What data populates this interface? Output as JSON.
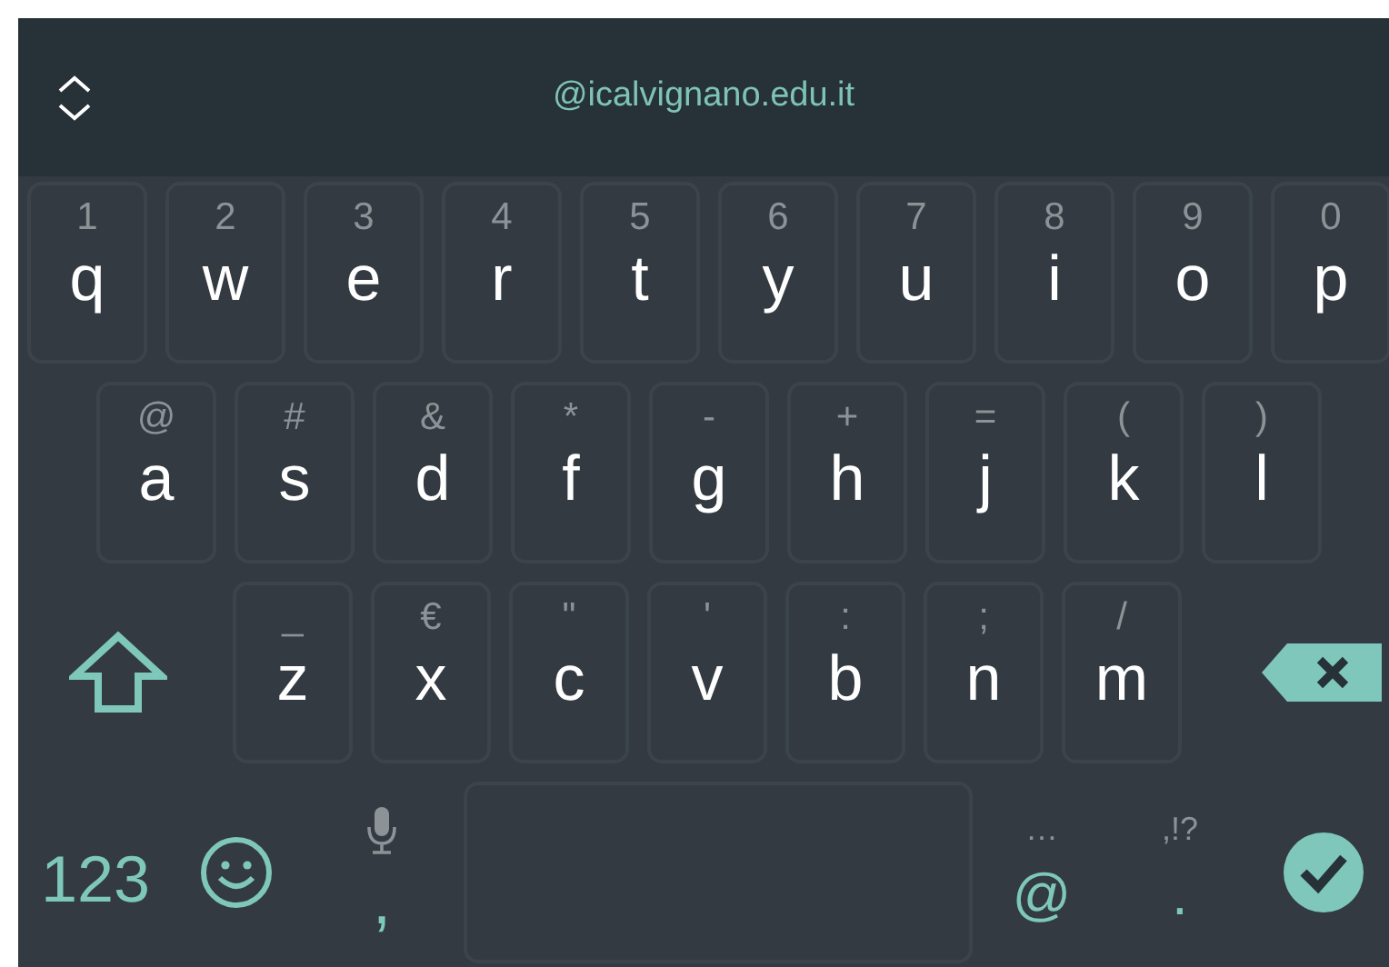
{
  "suggestion_bar": {
    "suggestion": "@icalvignano.edu.it"
  },
  "rows": [
    {
      "keys": [
        {
          "kind": "letter",
          "label": "q",
          "hint": "1"
        },
        {
          "kind": "letter",
          "label": "w",
          "hint": "2"
        },
        {
          "kind": "letter",
          "label": "e",
          "hint": "3"
        },
        {
          "kind": "letter",
          "label": "r",
          "hint": "4"
        },
        {
          "kind": "letter",
          "label": "t",
          "hint": "5"
        },
        {
          "kind": "letter",
          "label": "y",
          "hint": "6"
        },
        {
          "kind": "letter",
          "label": "u",
          "hint": "7"
        },
        {
          "kind": "letter",
          "label": "i",
          "hint": "8"
        },
        {
          "kind": "letter",
          "label": "o",
          "hint": "9"
        },
        {
          "kind": "letter",
          "label": "p",
          "hint": "0"
        }
      ]
    },
    {
      "keys": [
        {
          "kind": "letter",
          "label": "a",
          "hint": "@"
        },
        {
          "kind": "letter",
          "label": "s",
          "hint": "#"
        },
        {
          "kind": "letter",
          "label": "d",
          "hint": "&"
        },
        {
          "kind": "letter",
          "label": "f",
          "hint": "*"
        },
        {
          "kind": "letter",
          "label": "g",
          "hint": "-"
        },
        {
          "kind": "letter",
          "label": "h",
          "hint": "+"
        },
        {
          "kind": "letter",
          "label": "j",
          "hint": "="
        },
        {
          "kind": "letter",
          "label": "k",
          "hint": "("
        },
        {
          "kind": "letter",
          "label": "l",
          "hint": ")"
        }
      ]
    },
    {
      "keys": [
        {
          "kind": "shift"
        },
        {
          "kind": "letter",
          "label": "z",
          "hint": "_"
        },
        {
          "kind": "letter",
          "label": "x",
          "hint": "€"
        },
        {
          "kind": "letter",
          "label": "c",
          "hint": "\""
        },
        {
          "kind": "letter",
          "label": "v",
          "hint": "'"
        },
        {
          "kind": "letter",
          "label": "b",
          "hint": ":"
        },
        {
          "kind": "letter",
          "label": "n",
          "hint": ";"
        },
        {
          "kind": "letter",
          "label": "m",
          "hint": "/"
        },
        {
          "kind": "backspace"
        }
      ]
    }
  ],
  "bottom_row": [
    {
      "kind": "symbols",
      "label": "123"
    },
    {
      "kind": "emoji"
    },
    {
      "kind": "voice_punct",
      "label": ","
    },
    {
      "kind": "space"
    },
    {
      "kind": "punct",
      "label": "@",
      "hint": "…"
    },
    {
      "kind": "punct",
      "label": ".",
      "hint": ",!?"
    },
    {
      "kind": "enter"
    }
  ]
}
